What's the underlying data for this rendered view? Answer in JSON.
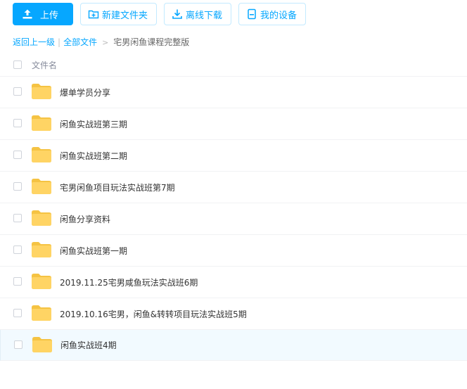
{
  "toolbar": {
    "upload_label": "上传",
    "new_folder_label": "新建文件夹",
    "offline_download_label": "离线下载",
    "my_devices_label": "我的设备"
  },
  "breadcrumb": {
    "back_label": "返回上一级",
    "separator": "|",
    "all_files_label": "全部文件",
    "arrow": ">",
    "current_label": "宅男闲鱼课程完整版"
  },
  "table": {
    "header_name": "文件名",
    "rows": [
      {
        "name": "爆单学员分享"
      },
      {
        "name": "闲鱼实战班第三期"
      },
      {
        "name": "闲鱼实战班第二期"
      },
      {
        "name": "宅男闲鱼项目玩法实战班第7期"
      },
      {
        "name": "闲鱼分享资料"
      },
      {
        "name": "闲鱼实战班第一期"
      },
      {
        "name": "2019.11.25宅男咸鱼玩法实战班6期"
      },
      {
        "name": "2019.10.16宅男，闲鱼&转转项目玩法实战班5期"
      },
      {
        "name": "闲鱼实战班4期",
        "hovered": true
      }
    ]
  },
  "colors": {
    "accent": "#06a7ff",
    "folder": "#ffd464",
    "folder_tab": "#f5c343",
    "row_hover": "#f2faff"
  },
  "icons": {
    "upload": "upload-icon",
    "new_folder": "folder-plus-icon",
    "offline_download": "download-icon",
    "my_devices": "device-icon",
    "folder": "folder-icon"
  }
}
